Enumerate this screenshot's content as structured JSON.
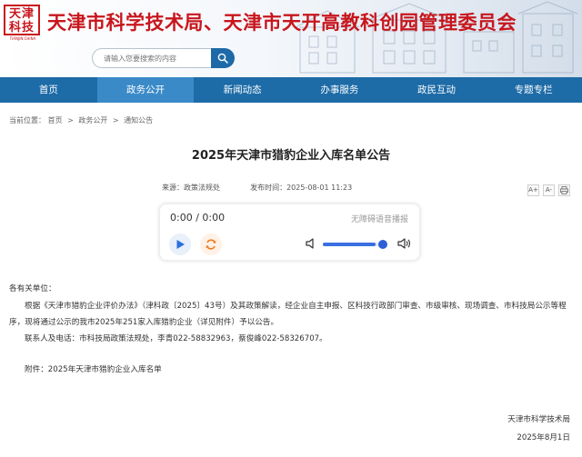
{
  "header": {
    "logo_seal_text": "天津\n科技",
    "logo_sub": "TIANJIN·CHINA",
    "site_title": "天津市科学技术局、天津市天开高教科创园管理委员会"
  },
  "search": {
    "placeholder": "请输入您要搜索的内容",
    "button_icon": "search-icon"
  },
  "nav": {
    "items": [
      {
        "label": "首页"
      },
      {
        "label": "政务公开"
      },
      {
        "label": "新闻动态"
      },
      {
        "label": "办事服务"
      },
      {
        "label": "政民互动"
      },
      {
        "label": "专题专栏"
      }
    ],
    "active_index": 1
  },
  "breadcrumb": {
    "prefix": "当前位置：",
    "items": [
      "首页",
      "政务公开",
      "通知公告"
    ],
    "separator": ">"
  },
  "article": {
    "title": "2025年天津市猎豹企业入库名单公告",
    "source": "来源：政策法规处",
    "publish_time": "发布时间：2025-08-01 11:23",
    "font_controls": [
      "A+",
      "A-",
      "print-icon"
    ]
  },
  "player": {
    "time": "0:00 / 0:00",
    "accessibility_label": "无障碍语音播报",
    "volume": 0.85,
    "icons": [
      "play-icon",
      "repeat-icon",
      "volume-low-icon",
      "volume-high-icon"
    ]
  },
  "content": {
    "salutation": "各有关单位：",
    "paragraph": "根据《天津市猎豹企业评价办法》（津科政〔2025〕43号）及其政策解读，经企业自主申报、区科技行政部门审查、市级审核、现场调查、市科技局公示等程序，现将通过公示的我市2025年251家入库猎豹企业（详见附件）予以公告。",
    "contact": "联系人及电话：市科技局政策法规处，李青022-58832963，蔡俊峰022-58326707。",
    "attachment": "附件：2025年天津市猎豹企业入库名单",
    "sign_org": "天津市科学技术局",
    "sign_date": "2025年8月1日"
  },
  "colors": {
    "brand_red": "#c8161d",
    "nav_blue": "#1d6ba7",
    "nav_active": "#3a8ac8",
    "player_accent": "#3b6fe0"
  }
}
